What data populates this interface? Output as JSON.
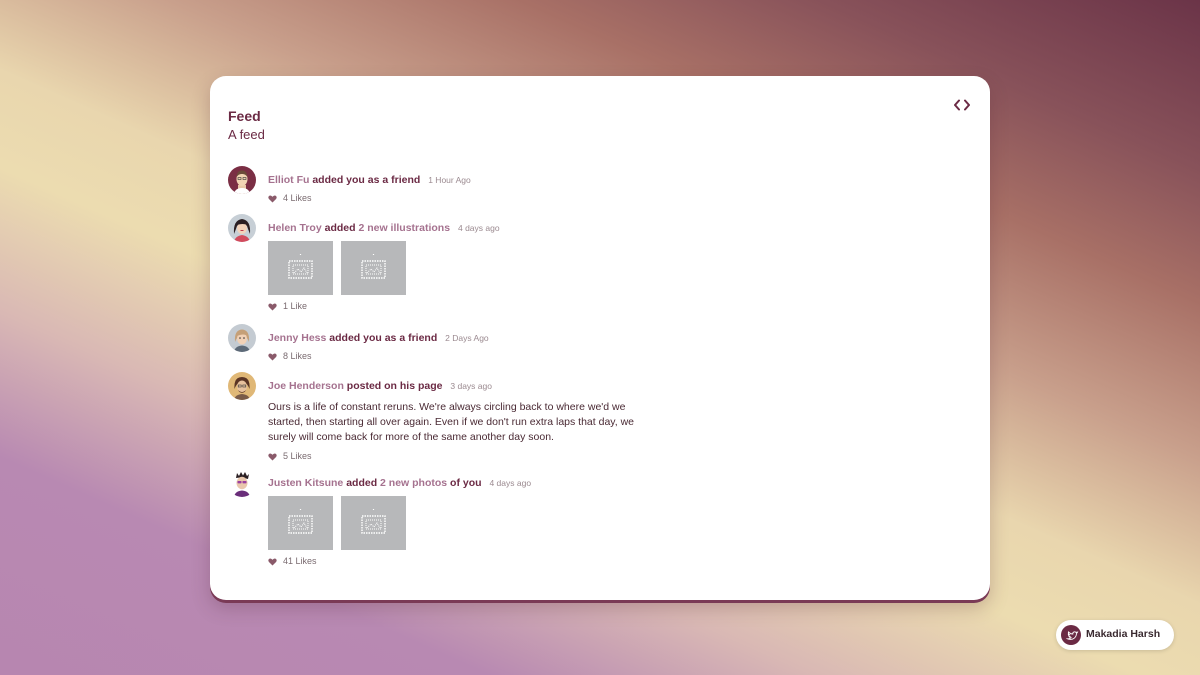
{
  "colors": {
    "accent": "#6b2a44",
    "link": "#a5728f",
    "placeholder": "#b7b8ba"
  },
  "header": {
    "title": "Feed",
    "subtitle": "A feed",
    "toggle_icon": "code-icon"
  },
  "feed": {
    "events": [
      {
        "user": "Elliot Fu",
        "action": "added you as a friend",
        "date": "1 Hour Ago",
        "likes": "4 Likes"
      },
      {
        "user": "Helen Troy",
        "action_prefix": "added",
        "link": "2 new illustrations",
        "date": "4 days ago",
        "images": [
          "image-placeholder",
          "image-placeholder"
        ],
        "likes": "1 Like"
      },
      {
        "user": "Jenny Hess",
        "action": "added you as a friend",
        "date": "2 Days Ago",
        "likes": "8 Likes"
      },
      {
        "user": "Joe Henderson",
        "action": "posted on his page",
        "date": "3 days ago",
        "text": "Ours is a life of constant reruns. We're always circling back to where we'd we started, then starting all over again. Even if we don't run extra laps that day, we surely will come back for more of the same another day soon.",
        "likes": "5 Likes"
      },
      {
        "user": "Justen Kitsune",
        "action_prefix": "added",
        "link": "2 new photos",
        "action_suffix": "of you",
        "date": "4 days ago",
        "images": [
          "image-placeholder",
          "image-placeholder"
        ],
        "likes": "41 Likes"
      }
    ]
  },
  "badge": {
    "label": "Makadia Harsh",
    "icon": "twitter-icon"
  }
}
